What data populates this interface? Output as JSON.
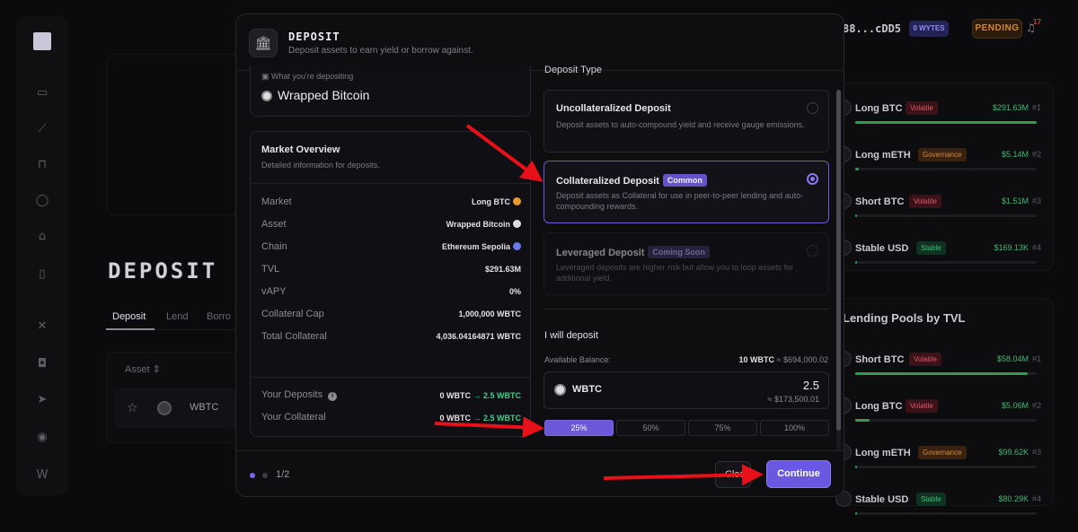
{
  "background": {
    "page_title": "DEPOSIT",
    "tabs": [
      {
        "label": "Deposit"
      },
      {
        "label": "Lend"
      },
      {
        "label": "Borro"
      }
    ],
    "table": {
      "header": "Asset",
      "sort_icon": "sort-icon",
      "row": {
        "symbol": "WBTC"
      }
    },
    "topbar": {
      "address": "88...cDD5",
      "bytes_badge": "0 WYTES",
      "pending": "PENDING",
      "notif_count": "17"
    },
    "pools": [
      {
        "name": "Long BTC",
        "badge": "Volatile",
        "tvl": "$291.63M",
        "rank": "#1",
        "fill_fraction": 1.0
      },
      {
        "name": "Long mETH",
        "badge": "Governance",
        "tvl": "$5.14M",
        "rank": "#2",
        "fill_fraction": 0.02
      },
      {
        "name": "Short BTC",
        "badge": "Volatile",
        "tvl": "$1.51M",
        "rank": "#3",
        "fill_fraction": 0.01
      },
      {
        "name": "Stable USD",
        "badge": "Stable",
        "tvl": "$169.13K",
        "rank": "#4",
        "fill_fraction": 0.005
      }
    ],
    "lending": {
      "title": "Lending Pools by TVL",
      "pools": [
        {
          "name": "Short BTC",
          "badge": "Volatile",
          "tvl": "$58.04M",
          "rank": "#1",
          "fill_fraction": 0.95
        },
        {
          "name": "Long BTC",
          "badge": "Volatile",
          "tvl": "$5.06M",
          "rank": "#2",
          "fill_fraction": 0.08
        },
        {
          "name": "Long mETH",
          "badge": "Governance",
          "tvl": "$99.62K",
          "rank": "#3",
          "fill_fraction": 0.01
        },
        {
          "name": "Stable USD",
          "badge": "Stable",
          "tvl": "$80.29K",
          "rank": "#4",
          "fill_fraction": 0.01
        }
      ]
    }
  },
  "modal": {
    "title": "DEPOSIT",
    "subtitle": "Deposit assets to earn yield or borrow against.",
    "depositing": {
      "label": "What you're depositing",
      "value": "Wrapped Bitcoin"
    },
    "market_overview": {
      "title": "Market Overview",
      "subtitle": "Detailed information for deposits.",
      "rows": [
        {
          "label": "Market",
          "value": "Long BTC"
        },
        {
          "label": "Asset",
          "value": "Wrapped Bitcoin"
        },
        {
          "label": "Chain",
          "value": "Ethereum Sepolia"
        },
        {
          "label": "TVL",
          "value": "$291.63M"
        },
        {
          "label": "vAPY",
          "value": "0%"
        },
        {
          "label": "Collateral Cap",
          "value": "1,000,000 WBTC"
        },
        {
          "label": "Total Collateral",
          "value": "4,036.04164871 WBTC"
        }
      ],
      "your_deposits": {
        "label": "Your Deposits",
        "from": "0 WBTC",
        "to": "2.5 WBTC"
      },
      "your_collateral": {
        "label": "Your Collateral",
        "from": "0 WBTC",
        "to": "2.5 WBTC"
      },
      "arrow": "→"
    },
    "deposit_type": {
      "title": "Deposit Type",
      "options": [
        {
          "title": "Uncollateralized Deposit",
          "badge": "",
          "desc": "Deposit assets to auto-compound yield and receive gauge emissions.",
          "selected": false,
          "disabled": false
        },
        {
          "title": "Collateralized Deposit",
          "badge": "Common",
          "desc": "Deposit assets as Collateral for use in peer-to-peer lending and auto-compounding rewards.",
          "selected": true,
          "disabled": false
        },
        {
          "title": "Leveraged Deposit",
          "badge": "Coming Soon",
          "desc": "Leveraged deposits are higher risk but allow you to loop assets for additional yield.",
          "selected": false,
          "disabled": true
        }
      ]
    },
    "will_deposit": {
      "title": "I will deposit",
      "balance_label": "Available Balance:",
      "balance_amount": "10 WBTC",
      "balance_usd": "≈ $694,000.02",
      "token": "WBTC",
      "amount": "2.5",
      "amount_usd": "≈ $173,500.01",
      "percents": [
        {
          "label": "25%",
          "active": true
        },
        {
          "label": "50%",
          "active": false
        },
        {
          "label": "75%",
          "active": false
        },
        {
          "label": "100%",
          "active": false
        }
      ]
    },
    "footer": {
      "step": "1/2",
      "close_label": "Close",
      "continue_label": "Continue"
    }
  },
  "colors": {
    "accent": "#6a58e0",
    "green": "#3fcf8a",
    "arrow": "#e8111a"
  }
}
